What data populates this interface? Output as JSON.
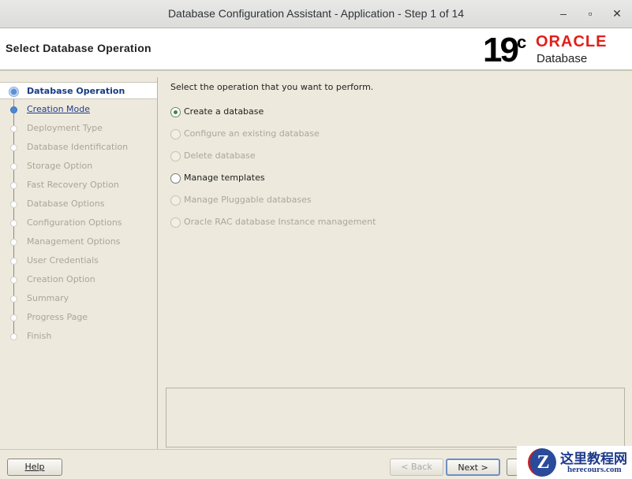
{
  "window": {
    "title": "Database Configuration Assistant - Application - Step 1 of 14",
    "minimize": "–",
    "maximize": "▫",
    "close": "✕"
  },
  "header": {
    "title": "Select Database Operation",
    "logo_version": "19",
    "logo_sup": "c",
    "logo_brand": "ORACLE",
    "logo_product": "Database"
  },
  "steps": [
    "Database Operation",
    "Creation Mode",
    "Deployment Type",
    "Database Identification",
    "Storage Option",
    "Fast Recovery Option",
    "Database Options",
    "Configuration Options",
    "Management Options",
    "User Credentials",
    "Creation Option",
    "Summary",
    "Progress Page",
    "Finish"
  ],
  "main": {
    "prompt": "Select the operation that you want to perform.",
    "options": [
      {
        "label": "Create a database",
        "selected": true,
        "enabled": true
      },
      {
        "label": "Configure an existing database",
        "selected": false,
        "enabled": false
      },
      {
        "label": "Delete database",
        "selected": false,
        "enabled": false
      },
      {
        "label": "Manage templates",
        "selected": false,
        "enabled": true
      },
      {
        "label": "Manage Pluggable databases",
        "selected": false,
        "enabled": false
      },
      {
        "label": "Oracle RAC database Instance management",
        "selected": false,
        "enabled": false
      }
    ]
  },
  "footer": {
    "help": "Help",
    "back": "< Back",
    "next": "Next >"
  },
  "watermark": {
    "title": "这里教程网",
    "url": "herecours.com"
  }
}
